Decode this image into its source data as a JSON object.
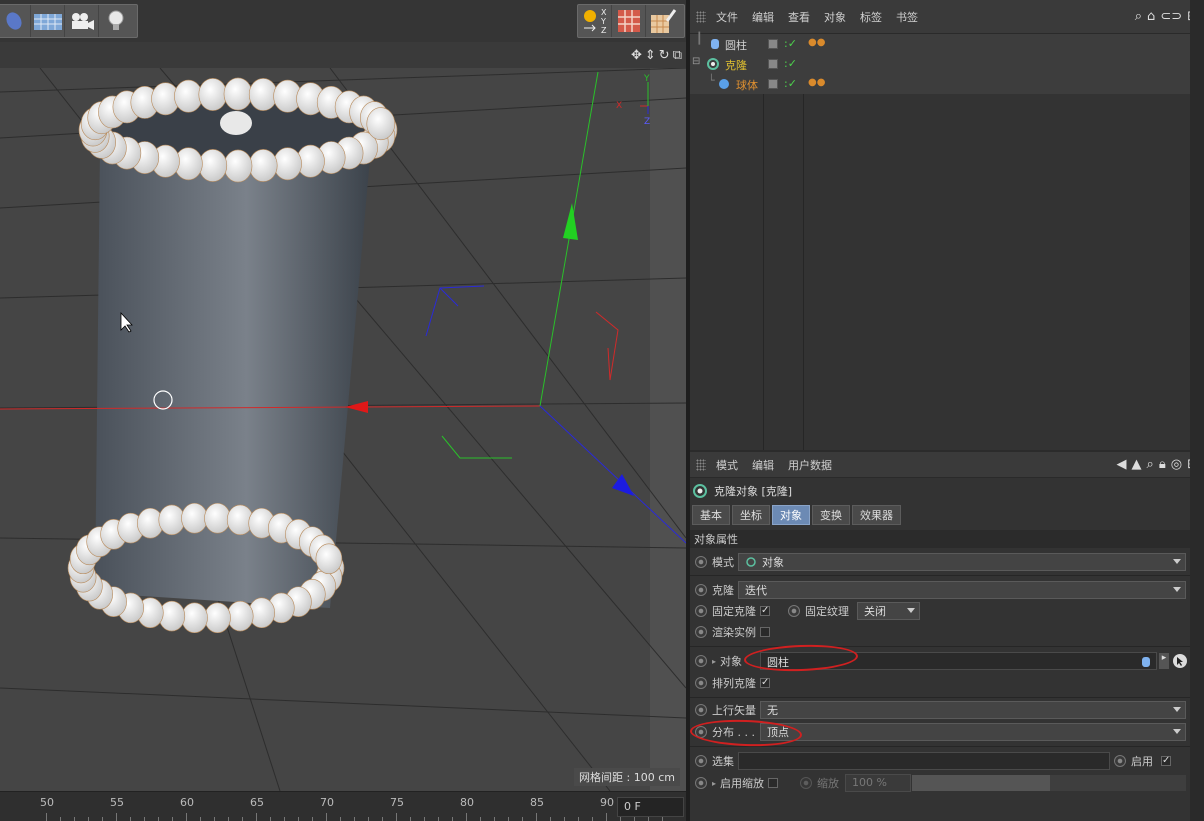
{
  "viewport": {
    "grid_spacing": "网格间距 : 100 cm",
    "axis_labels": {
      "x": "X",
      "y": "Y",
      "z": "Z"
    },
    "toolbar_icons": [
      "deformer-icon",
      "floor-grid-icon",
      "camera-icon",
      "light-icon",
      "xyz-axis-icon",
      "material-grid-icon",
      "paint-brush-icon"
    ]
  },
  "timeline": {
    "ticks": [
      "50",
      "55",
      "60",
      "65",
      "70",
      "75",
      "80",
      "85",
      "90"
    ],
    "frame": "0 F"
  },
  "object_manager": {
    "menu": [
      "文件",
      "编辑",
      "查看",
      "对象",
      "标签",
      "书签"
    ],
    "objects": [
      {
        "name": "圆柱",
        "color": "#d0d0d0"
      },
      {
        "name": "克隆",
        "color": "#e0c030"
      },
      {
        "name": "球体",
        "color": "#e09030"
      }
    ]
  },
  "attribute_manager": {
    "menu": [
      "模式",
      "编辑",
      "用户数据"
    ],
    "title": "克隆对象 [克隆]",
    "tabs": [
      "基本",
      "坐标",
      "对象",
      "变换",
      "效果器"
    ],
    "active_tab": "对象",
    "section": "对象属性",
    "mode_label": "模式",
    "mode_value": "对象",
    "clone_label": "克隆",
    "clone_value": "迭代",
    "fix_clone_label": "固定克隆",
    "fix_texture_label": "固定纹理",
    "fix_texture_value": "关闭",
    "render_instances_label": "渲染实例",
    "object_label": "对象",
    "object_value": "圆柱",
    "align_clone_label": "排列克隆",
    "up_vector_label": "上行矢量",
    "up_vector_value": "无",
    "distribution_label": "分布 . . .",
    "distribution_value": "顶点",
    "selection_label": "选集",
    "enable_label": "启用",
    "enable_scale_label": "启用缩放",
    "scale_label": "缩放",
    "scale_value": "100 %"
  }
}
